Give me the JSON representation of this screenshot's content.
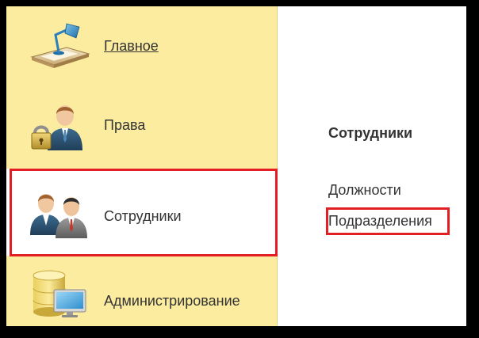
{
  "sidebar": {
    "items": [
      {
        "label": "Главное",
        "icon": "desk-lamp-icon",
        "underlined": true
      },
      {
        "label": "Права",
        "icon": "user-lock-icon"
      },
      {
        "label": "Сотрудники",
        "icon": "employees-icon",
        "selected": true
      },
      {
        "label": "Администрирование",
        "icon": "database-monitor-icon"
      }
    ]
  },
  "content": {
    "title": "Сотрудники",
    "links": [
      "Должности",
      "Подразделения"
    ],
    "highlighted_link": "Подразделения"
  },
  "colors": {
    "sidebar_bg": "#fbeca0",
    "highlight": "#e31e24",
    "text": "#333333"
  }
}
